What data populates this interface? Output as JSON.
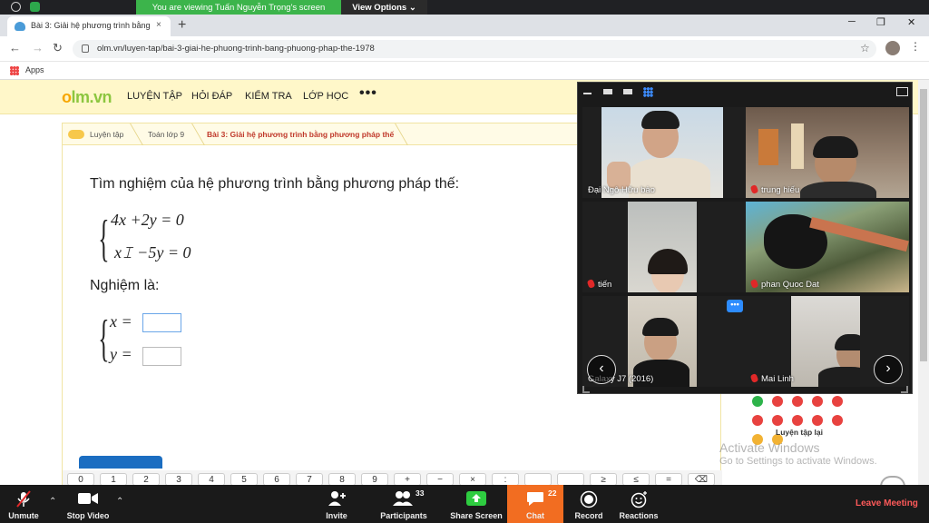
{
  "zoom": {
    "viewing_text": "You are viewing Tuấn Nguyễn Trọng's screen",
    "view_options": "View Options ⌄",
    "toolbar": {
      "unmute": "Unmute",
      "stop_video": "Stop Video",
      "invite": "Invite",
      "participants": "Participants",
      "participants_count": "33",
      "share_screen": "Share Screen",
      "chat": "Chat",
      "chat_count": "22",
      "record": "Record",
      "reactions": "Reactions",
      "leave": "Leave Meeting"
    },
    "participants": [
      {
        "name": "Đại Ngô Hữu bảo",
        "muted": false
      },
      {
        "name": "trung hiếu",
        "muted": true
      },
      {
        "name": "tiến",
        "muted": true
      },
      {
        "name": "phan Quoc Dat",
        "muted": true
      },
      {
        "name": "Galaxy J7 (2016)",
        "muted": false
      },
      {
        "name": "Mai Linh",
        "muted": true
      }
    ],
    "more_label": "•••"
  },
  "browser": {
    "tab_title": "Bài 3: Giải hệ phương trình bằng",
    "tab_close": "×",
    "new_tab": "+",
    "url": "olm.vn/luyen-tap/bai-3-giai-he-phuong-trinh-bang-phuong-phap-the-1978",
    "bookmark_apps": "Apps"
  },
  "olm": {
    "logo_o": "o",
    "logo_rest": "lm.vn",
    "nav": [
      "LUYỆN TẬP",
      "HỎI ĐÁP",
      "KIỂM TRA",
      "LỚP HỌC"
    ],
    "more": "•••",
    "breadcrumb": [
      "Luyện tập",
      "Toán lớp 9",
      "Bài 3: Giải hệ phương trình bằng phương pháp thế"
    ],
    "question": "Tìm nghiệm của hệ phương trình bằng phương pháp thế:",
    "eq1": "4x +2y  = 0",
    "eq2": "x𝙸 −5y  = 0",
    "answer_label": "Nghiệm là:",
    "x_label": "x =",
    "y_label": "y =",
    "keys": [
      "0",
      "1",
      "2",
      "3",
      "4",
      "5",
      "6",
      "7",
      "8",
      "9",
      "+",
      "−",
      "×",
      ":",
      "",
      "",
      "≥",
      "≤",
      "=",
      "⌫"
    ],
    "practice_again": "Luyện tập lại",
    "dot_colors": [
      "#2db34a",
      "#e8423f",
      "#e8423f",
      "#e8423f",
      "#e8423f",
      "#e8423f",
      "#e8423f",
      "#e8423f",
      "#e8423f",
      "#e8423f",
      "#f2b233",
      "#f2b233"
    ]
  },
  "windows": {
    "activate_title": "Activate Windows",
    "activate_sub": "Go to Settings to activate Windows."
  }
}
